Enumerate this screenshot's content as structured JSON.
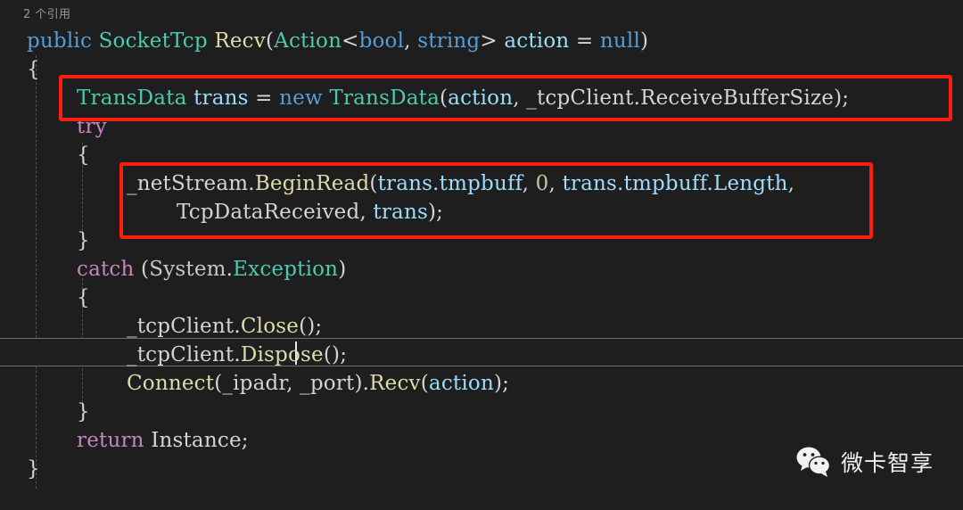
{
  "editor": {
    "background_color": "#1e1e1e",
    "codelens": "2 个引用",
    "language": "csharp",
    "current_line_number": 11,
    "caret_visible": true,
    "lines": [
      {
        "indent": 0,
        "text": "public SocketTcp Recv(Action<bool, string> action = null)"
      },
      {
        "indent": 0,
        "text": "{"
      },
      {
        "indent": 1,
        "text": "TransData trans = new TransData(action, _tcpClient.ReceiveBufferSize);"
      },
      {
        "indent": 1,
        "text": "try"
      },
      {
        "indent": 1,
        "text": "{"
      },
      {
        "indent": 2,
        "text": "_netStream.BeginRead(trans.tmpbuff, 0, trans.tmpbuff.Length,"
      },
      {
        "indent": 3,
        "text": "TcpDataReceived, trans);"
      },
      {
        "indent": 1,
        "text": "}"
      },
      {
        "indent": 1,
        "text": "catch (System.Exception)"
      },
      {
        "indent": 1,
        "text": "{"
      },
      {
        "indent": 2,
        "text": "_tcpClient.Close();"
      },
      {
        "indent": 2,
        "text": "_tcpClient.Dispose();"
      },
      {
        "indent": 2,
        "text": "Connect(_ipadr, _port).Recv(action);"
      },
      {
        "indent": 1,
        "text": "}"
      },
      {
        "indent": 1,
        "text": "return Instance;"
      },
      {
        "indent": 0,
        "text": "}"
      }
    ],
    "tokens": {
      "line1": {
        "public": "public",
        "type": "SocketTcp",
        "method": "Recv",
        "open_paren": "(",
        "action_type": "Action",
        "lt": "<",
        "bool": "bool",
        "comma": ", ",
        "string": "string",
        "gt": ">",
        "param": "action",
        "equals": " = ",
        "null": "null",
        "close_paren": ")"
      },
      "line3": {
        "type": "TransData",
        "var": "trans",
        "assign": " = ",
        "new": "new",
        "ctor": "TransData",
        "arg1": "action",
        "arg2": "_tcpClient.ReceiveBufferSize",
        "terminator": ");"
      },
      "line4": {
        "keyword": "try"
      },
      "line6": {
        "stream": "_netStream",
        "method": "BeginRead",
        "arg1": "trans.tmpbuff",
        "arg2": "0",
        "arg3": "trans.tmpbuff.Length",
        "arg4": "TcpDataReceived",
        "arg5": "trans"
      },
      "line9": {
        "keyword": "catch",
        "namespace": "System",
        "exception": "Exception"
      },
      "line11": {
        "text": "_tcpClient.Close();"
      },
      "line12": {
        "text": "_tcpClient.Dispose();"
      },
      "line13": {
        "method": "Connect",
        "arg1": "_ipadr",
        "arg2": "_port",
        "method2": "Recv",
        "arg3": "action"
      },
      "line15": {
        "keyword": "return",
        "value": "Instance",
        "terminator": ";"
      }
    },
    "colors": {
      "keyword": "#569cd6",
      "control_keyword": "#c586c0",
      "type": "#4ec9b0",
      "method": "#dcdcaa",
      "variable": "#9cdcfe",
      "plain": "#d4d4d4",
      "number": "#b5cea8",
      "codelens": "#9a9a9a",
      "annotation": "#fd1d10",
      "current_line_border": "#6e6e6e"
    }
  },
  "annotations": [
    {
      "label": "highlight-box-transdata",
      "target": "TransData trans = new TransData(action, _tcpClient.ReceiveBufferSize);"
    },
    {
      "label": "highlight-box-beginread",
      "target": "_netStream.BeginRead(trans.tmpbuff, 0, trans.tmpbuff.Length, TcpDataReceived, trans);"
    }
  ],
  "watermark": {
    "name": "微卡智享",
    "icon": "wechat-icon"
  }
}
